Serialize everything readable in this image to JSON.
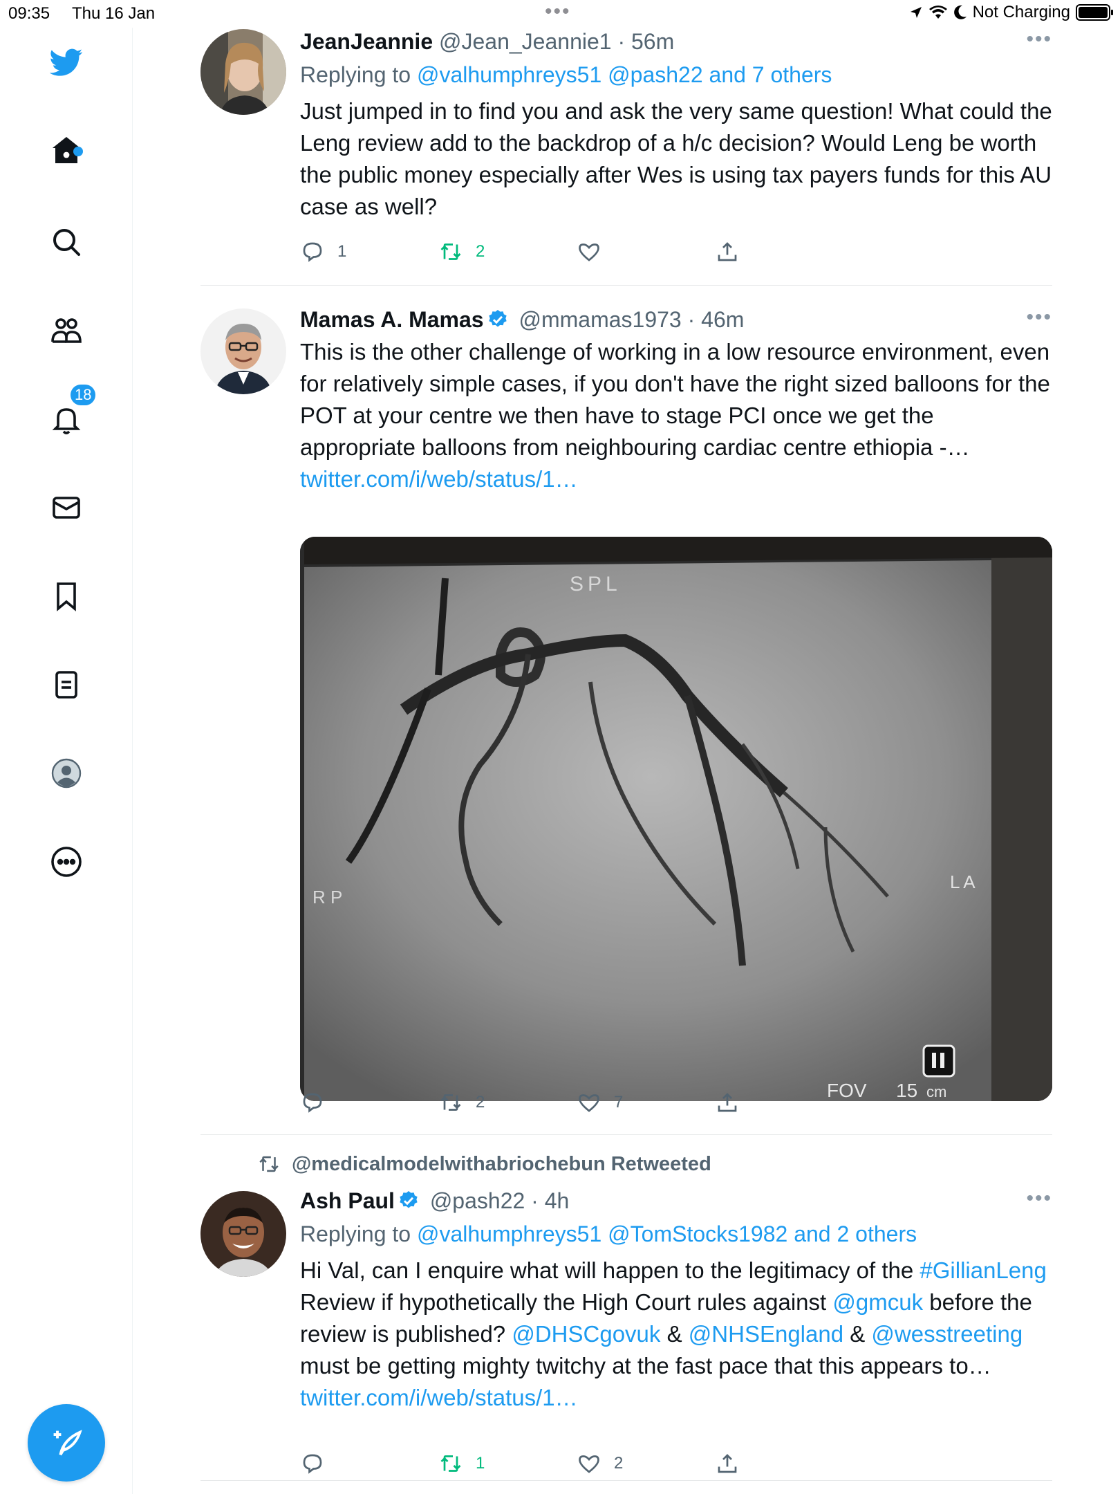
{
  "status_bar": {
    "time": "09:35",
    "date": "Thu 16 Jan",
    "battery_text": "Not Charging"
  },
  "sidebar": {
    "notifications_count": "18"
  },
  "tweets": [
    {
      "name": "JeanJeannie",
      "handle": "@Jean_Jeannie1",
      "time": "56m",
      "replying_prefix": "Replying to ",
      "replying_to": "@valhumphreys51 @pash22 and 7 others",
      "text": "Just jumped in to find you and ask the very same question! What could the Leng review add to the backdrop of  a h/c decision? Would Leng be worth the public money especially after Wes is using tax payers funds for this AU case as well?",
      "replies": "1",
      "retweets": "2",
      "likes": ""
    },
    {
      "name": "Mamas A. Mamas",
      "handle": "@mmamas1973",
      "time": "46m",
      "text": "This is the other challenge of working in a low resource environment, even for relatively simple cases, if you don't have the right sized balloons for the POT at your centre we then have to stage PCI once we get the appropriate balloons from neighbouring cardiac centre ethiopia -…",
      "link": "twitter.com/i/web/status/1…",
      "image_labels": {
        "top": "SPL",
        "left": "R P",
        "right": "L A",
        "fov": "FOV",
        "fov_value": "15",
        "fov_unit": "cm"
      },
      "replies": "",
      "retweets": "2",
      "likes": "7"
    },
    {
      "retweeted_by": "@medicalmodelwithabriochebun Retweeted",
      "name": "Ash Paul",
      "handle": "@pash22",
      "time": "4h",
      "replying_prefix": "Replying to ",
      "replying_to": "@valhumphreys51 @TomStocks1982 and 2 others",
      "text_parts": {
        "p1": "Hi Val, can I enquire what will happen to the legitimacy of the ",
        "tag1": "#GillianLeng",
        "p2": " Review if hypothetically the High Court rules against ",
        "m1": "@gmcuk",
        "p3": " before the review is published? ",
        "m2": "@DHSCgovuk",
        "p4": " & ",
        "m3": "@NHSEngland",
        "p5": " & ",
        "m4": "@wesstreeting",
        "p6": " must be getting mighty twitchy at the fast pace that this appears to… ",
        "link": "twitter.com/i/web/status/1…"
      },
      "replies": "",
      "retweets": "1",
      "likes": "2"
    }
  ],
  "colors": {
    "accent": "#1d9bf0",
    "retweet_active": "#00ba7c",
    "secondary_text": "#536471"
  }
}
